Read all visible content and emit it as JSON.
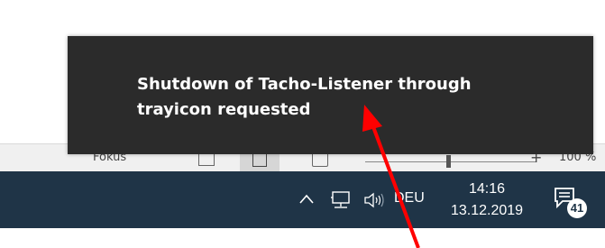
{
  "statusbar": {
    "focus_label": "Fokus",
    "zoom_plus": "+",
    "zoom_percent": "100 %"
  },
  "toast": {
    "message_line1": "Shutdown of Tacho-Listener through",
    "message_line2": "trayicon requested",
    "background": "#2b2b2b"
  },
  "taskbar": {
    "background": "#1f3447",
    "language": "DEU",
    "time": "14:16",
    "date": "13.12.2019",
    "notification_count": "41",
    "icons": [
      "chevron-up-icon",
      "network-icon",
      "volume-icon",
      "action-center-icon"
    ]
  },
  "annotation": {
    "arrow_color": "#ff0000"
  }
}
